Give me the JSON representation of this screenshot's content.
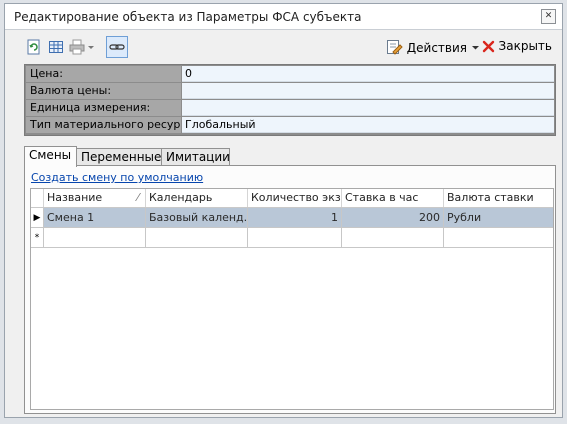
{
  "window": {
    "title": "Редактирование объекта из Параметры ФСА субъекта"
  },
  "toolbar": {
    "actions_label": "Действия",
    "close_label": "Закрыть"
  },
  "properties": [
    {
      "label": "Цена:",
      "value": "0"
    },
    {
      "label": "Валюта цены:",
      "value": ""
    },
    {
      "label": "Единица измерения:",
      "value": ""
    },
    {
      "label": "Тип материального ресурса:",
      "value": "Глобальный"
    }
  ],
  "tabs": [
    {
      "label": "Смены",
      "active": true
    },
    {
      "label": "Переменные",
      "active": false
    },
    {
      "label": "Имитации",
      "active": false
    }
  ],
  "shifts": {
    "create_default_link": "Создать смену по умолчанию",
    "columns": [
      "Название",
      "Календарь",
      "Количество экз...",
      "Ставка в час",
      "Валюта ставки"
    ],
    "rows": [
      {
        "name": "Смена 1",
        "calendar": "Базовый календ...",
        "count": "1",
        "rate": "200",
        "currency": "Рубли"
      }
    ],
    "new_row_marker": "*"
  },
  "colors": {
    "selected_row": "#b9c7d7",
    "property_label_bg": "#a7a7a7",
    "property_value_bg": "#eef5fc",
    "link": "#0645ad",
    "close_icon": "#d9261c"
  }
}
